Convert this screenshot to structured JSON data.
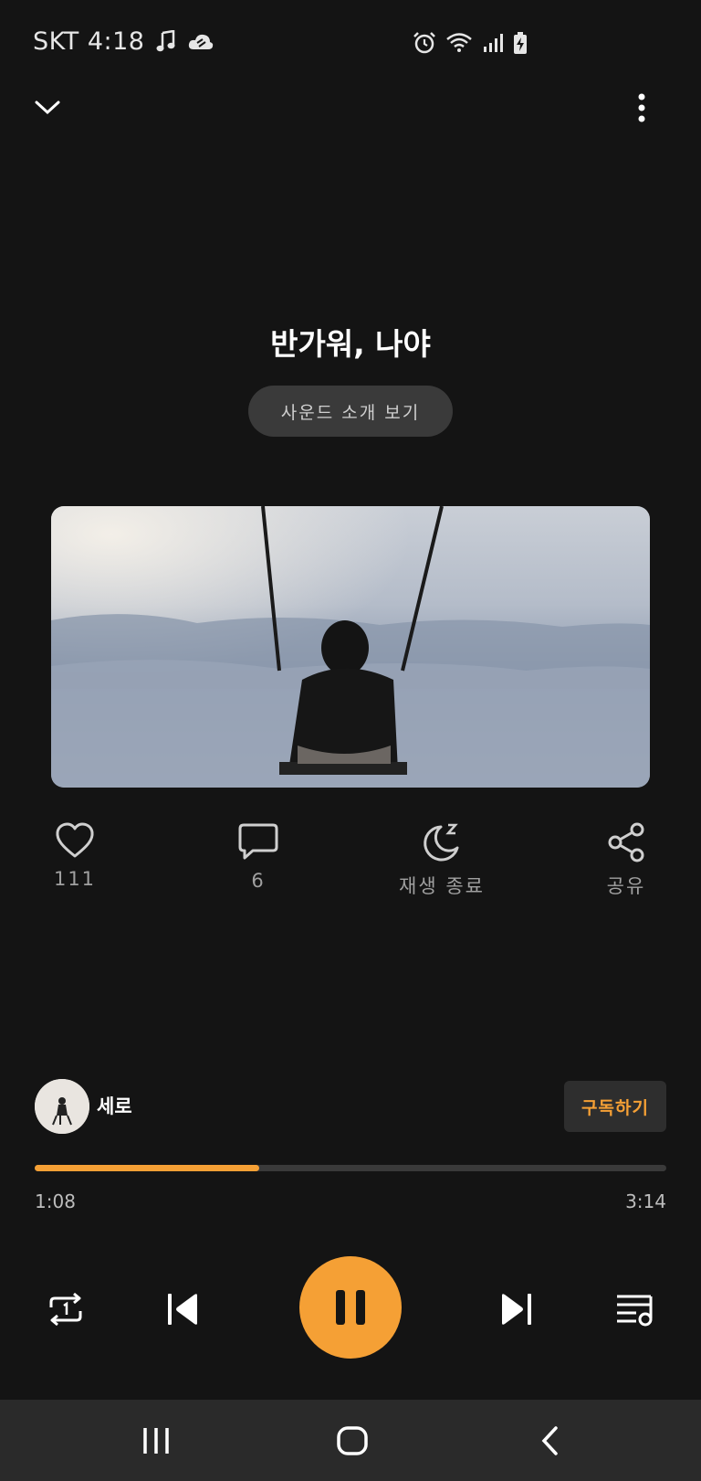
{
  "status_bar": {
    "carrier_time": "SKT 4:18",
    "icons": [
      "music-note-icon",
      "cloud-icon",
      "alarm-icon",
      "wifi-icon",
      "signal-icon",
      "battery-charging-icon"
    ]
  },
  "header": {
    "collapse_icon": "chevron-down-icon",
    "menu_icon": "more-vert-icon"
  },
  "track": {
    "title": "반가워, 나야",
    "intro_button": "사운드 소개 보기"
  },
  "actions": [
    {
      "icon": "heart-icon",
      "label": "111"
    },
    {
      "icon": "comment-icon",
      "label": "6"
    },
    {
      "icon": "sleep-timer-icon",
      "label": "재생 종료"
    },
    {
      "icon": "share-icon",
      "label": "공유"
    }
  ],
  "artist": {
    "name": "세로",
    "subscribe_label": "구독하기"
  },
  "playback": {
    "current_time": "1:08",
    "total_time": "3:14",
    "progress": 0.355
  },
  "colors": {
    "accent": "#f5a035",
    "background": "#141414"
  }
}
